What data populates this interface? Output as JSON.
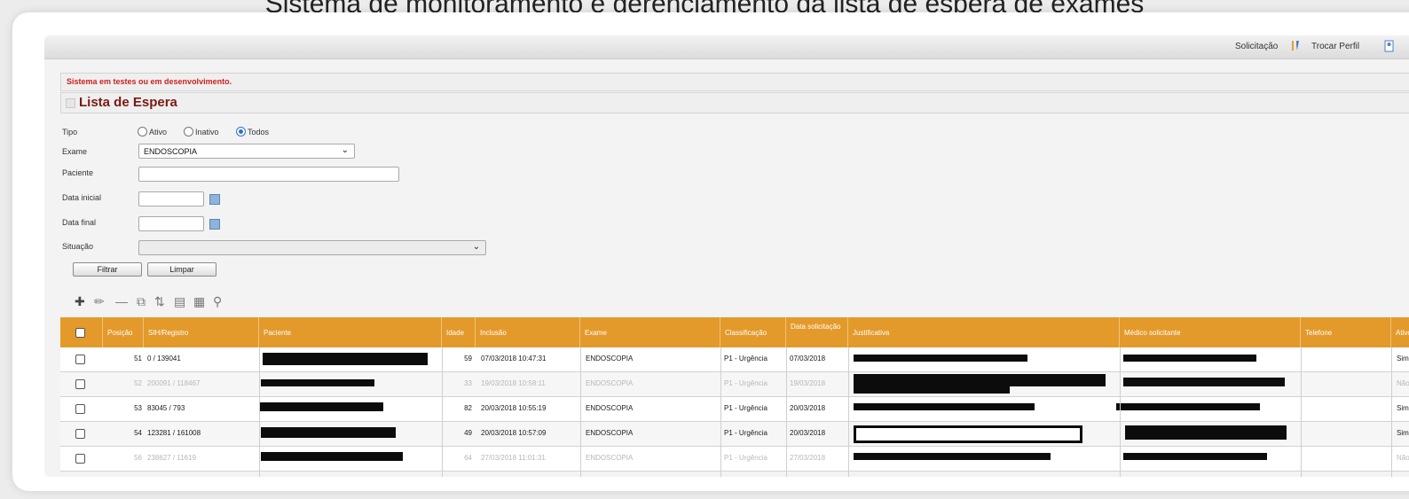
{
  "caption": "Sistema de monitoramento e gerenciamento da lista de espera de exames",
  "topbar": {
    "solicitacao": "Solicitação",
    "trocar_perfil": "Trocar Perfil"
  },
  "warning": "Sistema em testes ou em desenvolvimento.",
  "page_title": "Lista de Espera",
  "form": {
    "tipo_label": "Tipo",
    "tipo_options": [
      "Ativo",
      "Inativo",
      "Todos"
    ],
    "tipo_selected": "Todos",
    "exame_label": "Exame",
    "exame_value": "ENDOSCOPIA",
    "paciente_label": "Paciente",
    "data_inicial_label": "Data inicial",
    "data_final_label": "Data final",
    "situacao_label": "Situação",
    "filtrar": "Filtrar",
    "limpar": "Limpar"
  },
  "toolbar_icons": [
    "add-icon",
    "edit-icon",
    "remove-icon",
    "copy-icon",
    "move-icon",
    "folder-icon",
    "list-icon",
    "search-icon"
  ],
  "colors": {
    "header": "#e39a2b",
    "title": "#7a1a12",
    "warning": "#cc1f1f"
  },
  "table": {
    "columns": [
      "Posição",
      "SIH/Registro",
      "Paciente",
      "Idade",
      "Inclusão",
      "Exame",
      "Classificação",
      "Data solicitação",
      "Justificativa",
      "Médico solicitante",
      "Telefone",
      "Ativo"
    ],
    "rows": [
      {
        "posicao": "51",
        "registro": "0 / 139041",
        "idade": "59",
        "inclusao": "07/03/2018 10:47:31",
        "exame": "ENDOSCOPIA",
        "classificacao": "P1 - Urgência",
        "data": "07/03/2018",
        "ativo": "Sim",
        "faded": false
      },
      {
        "posicao": "52",
        "registro": "200091 / 118467",
        "idade": "33",
        "inclusao": "19/03/2018 10:58:11",
        "exame": "ENDOSCOPIA",
        "classificacao": "P1 - Urgência",
        "data": "19/03/2018",
        "ativo": "Não",
        "faded": true
      },
      {
        "posicao": "53",
        "registro": "83045 / 793",
        "idade": "82",
        "inclusao": "20/03/2018 10:55:19",
        "exame": "ENDOSCOPIA",
        "classificacao": "P1 - Urgência",
        "data": "20/03/2018",
        "ativo": "Sim",
        "faded": false
      },
      {
        "posicao": "54",
        "registro": "123281 / 161008",
        "idade": "49",
        "inclusao": "20/03/2018 10:57:09",
        "exame": "ENDOSCOPIA",
        "classificacao": "P1 - Urgência",
        "data": "20/03/2018",
        "ativo": "Sim",
        "faded": false
      },
      {
        "posicao": "56",
        "registro": "238627 / 11619",
        "idade": "64",
        "inclusao": "27/03/2018 11:01:31",
        "exame": "ENDOSCOPIA",
        "classificacao": "P1 - Urgência",
        "data": "27/03/2018",
        "ativo": "Não",
        "faded": true
      }
    ]
  }
}
